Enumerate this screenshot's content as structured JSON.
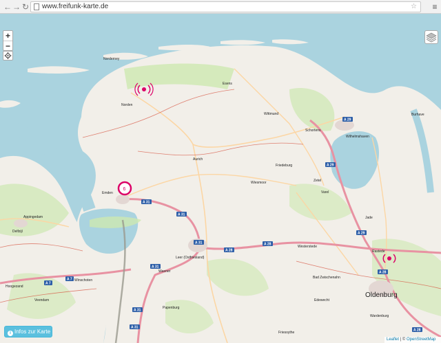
{
  "browser": {
    "back_icon": "back-arrow-icon",
    "forward_icon": "forward-arrow-icon",
    "reload_icon": "reload-icon",
    "url": "www.freifunk-karte.de",
    "star_icon": "star-icon",
    "menu_icon": "hamburger-menu-icon"
  },
  "map_controls": {
    "zoom_in": "+",
    "zoom_out": "−",
    "locate_icon": "crosshair-icon",
    "layers_icon": "layers-icon"
  },
  "info_button": {
    "label": "Infos zur Karte",
    "icon": "i"
  },
  "attribution": {
    "leaflet": "Leaflet",
    "separator": " | © ",
    "osm": "OpenStreetMap"
  },
  "cluster": {
    "count": "6",
    "color": "#dc0067"
  },
  "colors": {
    "sea": "#aad3df",
    "land": "#f2efe9",
    "green": "#cde8b0",
    "motorway": "#e892a2",
    "primary": "#fcd6a4",
    "brand": "#dc0067"
  },
  "labels": {
    "norderney": "Norderney",
    "norden": "Norden",
    "wittmund": "Wittmund",
    "esens": "Esens",
    "aurich": "Aurich",
    "friedeburg": "Friedeburg",
    "wiesmoor": "Wiesmoor",
    "zetel": "Zetel",
    "schortens": "Schortens",
    "wilhelmshaven": "Wilhelmshaven",
    "burhave": "Burhave",
    "jade": "Jade",
    "appingedam": "Appingedam",
    "delfzijl": "Delfzijl",
    "leer": "Leer (Ostfriesland)",
    "westerstede": "Westerstede",
    "bad_zwischenahn": "Bad Zwischenahn",
    "oldenburg": "Oldenburg",
    "papenburg": "Papenburg",
    "veendam": "Veendam",
    "winschoten": "Winschoten",
    "hoogezand": "Hoogezand",
    "edewecht": "Edewecht",
    "weener": "Weener",
    "varel": "Varel",
    "wardenburg": "Wardenburg",
    "friesoythe": "Friesoythe",
    "rastede": "Rastede",
    "emden": "Emden"
  },
  "shields": {
    "a31a": "A 31",
    "a31b": "A 31",
    "a31c": "A 31",
    "a31d": "A 31",
    "a31e": "A 31",
    "a31f": "A 31",
    "a28a": "A 28",
    "a28b": "A 28",
    "a28c": "A 28",
    "a28d": "A 28",
    "a29a": "A 29",
    "a29b": "A 29",
    "a29c": "A 29",
    "a7a": "A 7",
    "a7b": "A 7"
  }
}
